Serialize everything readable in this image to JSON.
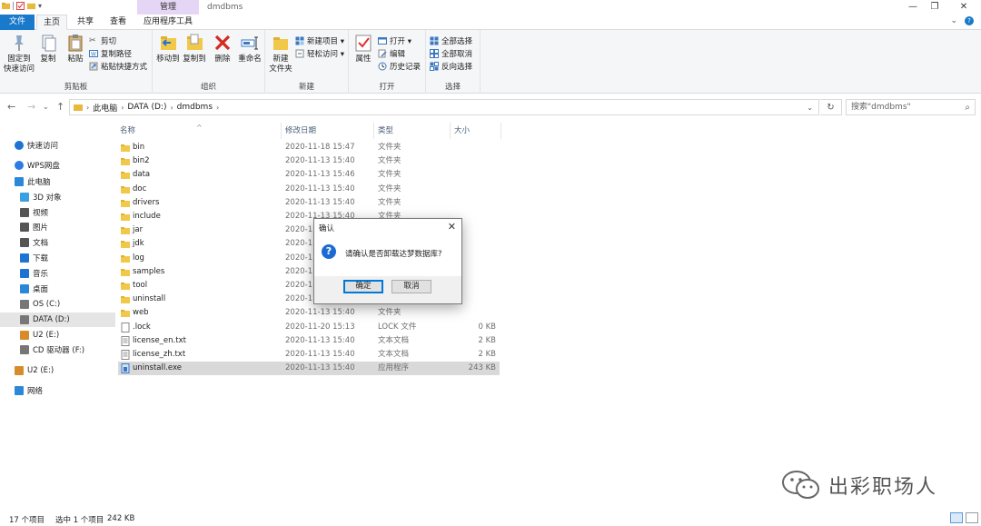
{
  "window": {
    "title": "dmdbms",
    "context_tab": "管理",
    "controls": [
      "—",
      "❐",
      "✕"
    ]
  },
  "ribbon_tabs": [
    "文件",
    "主页",
    "共享",
    "查看",
    "应用程序工具"
  ],
  "ribbon": {
    "clipboard": {
      "label": "剪贴板",
      "pin": "固定到\n快速访问",
      "copy": "复制",
      "paste": "粘贴",
      "cut": "剪切",
      "copy_path": "复制路径",
      "paste_shortcut": "粘贴快捷方式"
    },
    "organize": {
      "label": "组织",
      "move_to": "移动到",
      "copy_to": "复制到",
      "delete": "删除",
      "rename": "重命名"
    },
    "new": {
      "label": "新建",
      "new_folder": "新建\n文件夹",
      "new_item": "新建项目 ▾",
      "easy_access": "轻松访问 ▾"
    },
    "open": {
      "label": "打开",
      "properties": "属性",
      "open": "打开 ▾",
      "edit": "编辑",
      "history": "历史记录"
    },
    "select": {
      "label": "选择",
      "select_all": "全部选择",
      "select_none": "全部取消",
      "invert": "反向选择"
    }
  },
  "address": {
    "breadcrumbs": [
      "此电脑",
      "DATA (D:)",
      "dmdbms"
    ],
    "search_placeholder": "搜索\"dmdbms\""
  },
  "nav_pane": [
    {
      "label": "快速访问",
      "icon": "star-icon",
      "color": "#1e74d1"
    },
    {
      "label": "WPS网盘",
      "icon": "cloud-icon",
      "color": "#2d7be5"
    },
    {
      "label": "此电脑",
      "icon": "computer-icon",
      "color": "#2b88d8"
    },
    {
      "label": "3D 对象",
      "icon": "cube-icon",
      "color": "#3aa0e0"
    },
    {
      "label": "视频",
      "icon": "video-icon",
      "color": "#555"
    },
    {
      "label": "图片",
      "icon": "picture-icon",
      "color": "#555"
    },
    {
      "label": "文档",
      "icon": "document-icon",
      "color": "#555"
    },
    {
      "label": "下载",
      "icon": "download-icon",
      "color": "#1e74d1"
    },
    {
      "label": "音乐",
      "icon": "music-icon",
      "color": "#1e74d1"
    },
    {
      "label": "桌面",
      "icon": "desktop-icon",
      "color": "#2b88d8"
    },
    {
      "label": "OS (C:)",
      "icon": "drive-icon",
      "color": "#777"
    },
    {
      "label": "DATA (D:)",
      "icon": "drive-icon",
      "color": "#777"
    },
    {
      "label": "U2 (E:)",
      "icon": "usb-drive-icon",
      "color": "#d88b2b"
    },
    {
      "label": "CD 驱动器 (F:)",
      "icon": "cd-drive-icon",
      "color": "#777"
    },
    {
      "label": "U2 (E:)",
      "icon": "usb-drive-icon",
      "color": "#d88b2b"
    },
    {
      "label": "网络",
      "icon": "network-icon",
      "color": "#2b88d8"
    }
  ],
  "columns": [
    "名称",
    "修改日期",
    "类型",
    "大小"
  ],
  "files": [
    {
      "name": "bin",
      "date": "2020-11-18 15:47",
      "type": "文件夹",
      "size": "",
      "kind": "folder"
    },
    {
      "name": "bin2",
      "date": "2020-11-13 15:40",
      "type": "文件夹",
      "size": "",
      "kind": "folder"
    },
    {
      "name": "data",
      "date": "2020-11-13 15:46",
      "type": "文件夹",
      "size": "",
      "kind": "folder"
    },
    {
      "name": "doc",
      "date": "2020-11-13 15:40",
      "type": "文件夹",
      "size": "",
      "kind": "folder"
    },
    {
      "name": "drivers",
      "date": "2020-11-13 15:40",
      "type": "文件夹",
      "size": "",
      "kind": "folder"
    },
    {
      "name": "include",
      "date": "2020-11-13 15:40",
      "type": "文件夹",
      "size": "",
      "kind": "folder"
    },
    {
      "name": "jar",
      "date": "2020-1",
      "type": "",
      "size": "",
      "kind": "folder"
    },
    {
      "name": "jdk",
      "date": "2020-1",
      "type": "",
      "size": "",
      "kind": "folder"
    },
    {
      "name": "log",
      "date": "2020-1",
      "type": "",
      "size": "",
      "kind": "folder"
    },
    {
      "name": "samples",
      "date": "2020-1",
      "type": "",
      "size": "",
      "kind": "folder"
    },
    {
      "name": "tool",
      "date": "2020-1",
      "type": "",
      "size": "",
      "kind": "folder"
    },
    {
      "name": "uninstall",
      "date": "2020-1",
      "type": "",
      "size": "",
      "kind": "folder"
    },
    {
      "name": "web",
      "date": "2020-11-13 15:40",
      "type": "文件夹",
      "size": "",
      "kind": "folder"
    },
    {
      "name": ".lock",
      "date": "2020-11-20 15:13",
      "type": "LOCK 文件",
      "size": "0 KB",
      "kind": "file"
    },
    {
      "name": "license_en.txt",
      "date": "2020-11-13 15:40",
      "type": "文本文档",
      "size": "2 KB",
      "kind": "text"
    },
    {
      "name": "license_zh.txt",
      "date": "2020-11-13 15:40",
      "type": "文本文档",
      "size": "2 KB",
      "kind": "text"
    },
    {
      "name": "uninstall.exe",
      "date": "2020-11-13 15:40",
      "type": "应用程序",
      "size": "243 KB",
      "kind": "exe",
      "selected": true
    }
  ],
  "status": {
    "count": "17 个项目",
    "selection": "选中 1 个项目",
    "size": "242 KB"
  },
  "dialog": {
    "title": "确认",
    "message": "请确认是否卸载达梦数据库?",
    "ok": "确定",
    "cancel": "取消"
  },
  "watermark": {
    "text": "出彩职场人"
  }
}
